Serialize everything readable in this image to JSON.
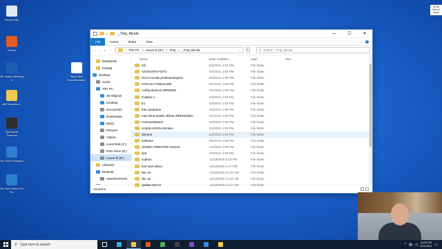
{
  "desktop_icons": [
    {
      "label": "Recycle Bin",
      "color": "#dfe8f2"
    },
    {
      "label": "Firefox",
      "color": "#e55b1f"
    },
    {
      "label": "HP Instant Meeting II",
      "color": "#1f5fb5"
    },
    {
      "label": "ANP-Baseline...",
      "color": "#f2c94c"
    },
    {
      "label": "Openwebf Terminal",
      "color": "#2d2d2d"
    },
    {
      "label": "Vis 2020 Prototype",
      "color": "#2d7fd0"
    },
    {
      "label": "Vis 2020 Visual SS Pro",
      "color": "#2d7fd0"
    },
    {
      "label": "Nicht Spe Documentation",
      "color": "#ffffff"
    }
  ],
  "corner_clock": {
    "line1": "10:35",
    "line2": "Nov 11",
    "line3": "Issue"
  },
  "window": {
    "title": "_Tmp_Nicola",
    "controls": {
      "minimize": "—",
      "maximize": "☐",
      "close": "✕"
    },
    "ribbon_tabs": [
      "File",
      "Home",
      "Share",
      "View"
    ],
    "address": {
      "segments": [
        "This PC",
        "nuovo-R (R:)",
        "Tmp",
        "_Tmp_Nicola"
      ],
      "separator": ">"
    },
    "search_placeholder": "Search _Tmp_Nicola",
    "columns": {
      "name": "Name",
      "date": "Date modified",
      "type": "Type",
      "size": "Size"
    },
    "nav_items": [
      {
        "label": "tambaDisk",
        "color": "#e8c04b"
      },
      {
        "label": "toSnap",
        "color": "#e8c04b"
      },
      {
        "label": "Desktop",
        "color": "#3b8fd9"
      },
      {
        "label": "nicola",
        "color": "#8a8a8a"
      },
      {
        "label": "This PC",
        "color": "#3b8fd9"
      },
      {
        "label": "3D Objects",
        "color": "#3b8fd9"
      },
      {
        "label": "Desktop",
        "color": "#3b8fd9"
      },
      {
        "label": "Documents",
        "color": "#8a8a8a"
      },
      {
        "label": "Downloads",
        "color": "#3b8fd9"
      },
      {
        "label": "Music",
        "color": "#3b8fd9"
      },
      {
        "label": "Pictures",
        "color": "#8a8a8a"
      },
      {
        "label": "Videos",
        "color": "#8a8a8a"
      },
      {
        "label": "Local Disk (C:)",
        "color": "#8a8a8a"
      },
      {
        "label": "DVD Drive (D:)",
        "color": "#8a8a8a"
      },
      {
        "label": "nuovo-R (R:)",
        "color": "#8a8a8a"
      },
      {
        "label": "Libraries",
        "color": "#e8c04b"
      },
      {
        "label": "Network",
        "color": "#3b8fd9"
      },
      {
        "label": "AMADAVPSS3",
        "color": "#8a8a8a"
      },
      {
        "label": "Control Panel",
        "color": "#3b8fd9"
      }
    ],
    "files": [
      {
        "name": "td1",
        "date": "5/4/2021 2:04 PM",
        "type": "File folder"
      },
      {
        "name": "AGGIUNTA FOTO",
        "date": "5/4/2021 1:59 PM",
        "type": "File folder"
      },
      {
        "name": "becco-sonda-prelevacampioni",
        "date": "5/4/2021 1:59 PM",
        "type": "File folder"
      },
      {
        "name": "COCLEA TUBOLARE",
        "date": "5/4/2021 1:59 PM",
        "type": "File folder"
      },
      {
        "name": "config-dominio-WINDOM",
        "date": "5/4/2021 1:59 PM",
        "type": "File folder"
      },
      {
        "name": "Copleto 1",
        "date": "5/4/2021 1:59 PM",
        "type": "File folder"
      },
      {
        "name": "E1",
        "date": "5/4/2021 1:59 PM",
        "type": "File folder"
      },
      {
        "name": "foto campione",
        "date": "5/4/2021 1:59 PM",
        "type": "File folder"
      },
      {
        "name": "macchina analisi offerta IPERSONDA",
        "date": "5/4/2021 1:59 PM",
        "type": "File folder"
      },
      {
        "name": "PcSmartSketch",
        "date": "5/4/2021 1:59 PM",
        "type": "File folder"
      },
      {
        "name": "scripts-LOGIN-dominio",
        "date": "5/4/2021 1:59 PM",
        "type": "File folder"
      },
      {
        "name": "Simone",
        "date": "5/4/2021 1:59 PM",
        "type": "File folder"
      },
      {
        "name": "software",
        "date": "5/4/2021 1:59 PM",
        "type": "File folder"
      },
      {
        "name": "SONDA FINESTRE NUOVA",
        "date": "5/4/2021 1:59 PM",
        "type": "File folder"
      },
      {
        "name": "sp3",
        "date": "5/4/2021 1:59 PM",
        "type": "File folder"
      },
      {
        "name": "sophos",
        "date": "12/18/2020 2:23 PM",
        "type": "File folder"
      },
      {
        "name": "test-user-allrun",
        "date": "12/18/2020 3:47 PM",
        "type": "File folder"
      },
      {
        "name": "WL-v3",
        "date": "12/18/2020 11:20 AM",
        "type": "File folder"
      },
      {
        "name": "WL-v2",
        "date": "12/18/2020 11:32 AM",
        "type": "File folder"
      },
      {
        "name": "update-WLCS",
        "date": "12/18/2020 11:27 AM",
        "type": "File folder"
      }
    ],
    "hovered_index": 11,
    "status_text": "52 items"
  },
  "taskbar": {
    "search_placeholder": "Type here to search",
    "apps": [
      {
        "name": "task-view-icon",
        "color": "#ffffff"
      },
      {
        "name": "edge-icon",
        "color": "#3bb0e8"
      },
      {
        "name": "file-explorer-icon",
        "color": "#f2c94c"
      },
      {
        "name": "firefox-icon",
        "color": "#e55b1f"
      },
      {
        "name": "chrome-icon",
        "color": "#4caf50"
      },
      {
        "name": "terminal-icon",
        "color": "#444444"
      },
      {
        "name": "visual-studio-icon",
        "color": "#7b4fc9"
      },
      {
        "name": "vscode-icon",
        "color": "#2f8fe0"
      },
      {
        "name": "app-icon",
        "color": "#f2c94c"
      }
    ],
    "active_app_index": 2,
    "clock_time": "10:35 PM",
    "clock_date": "5/11/2021"
  }
}
